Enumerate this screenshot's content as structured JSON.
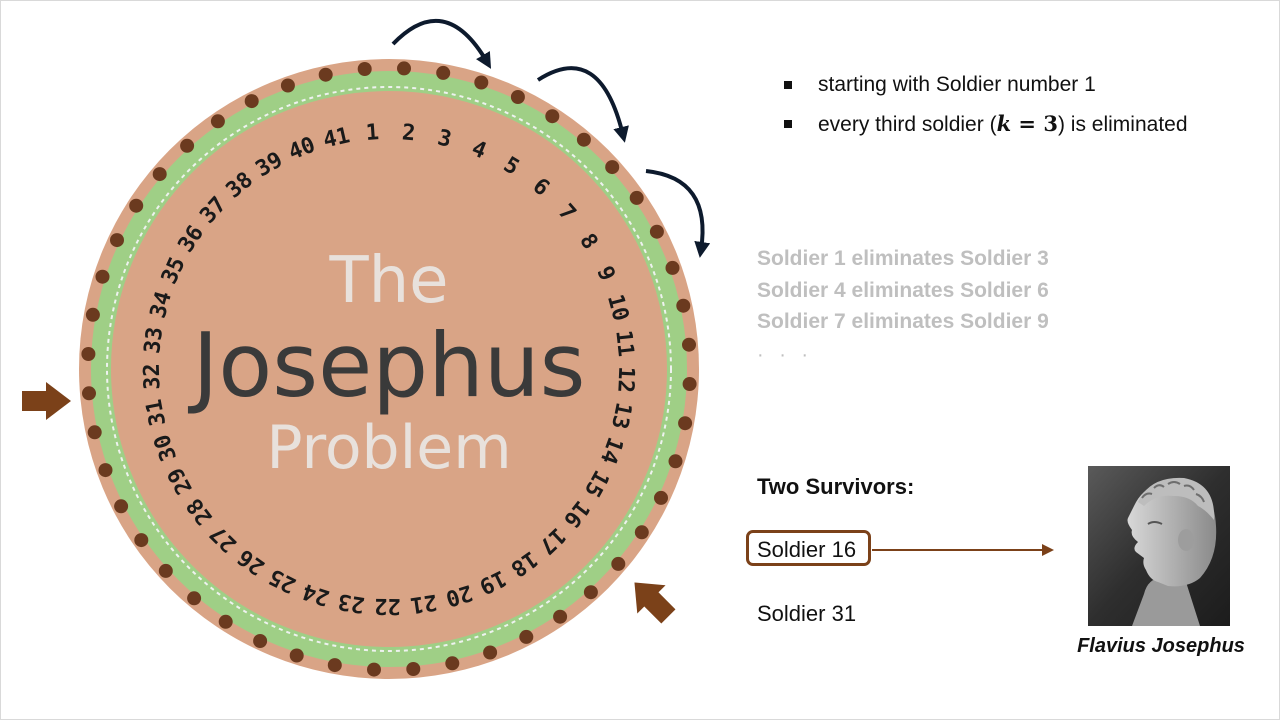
{
  "title": {
    "line1": "The",
    "line2": "Josephus",
    "line3": "Problem"
  },
  "soldier_numbers": [
    "1",
    "2",
    "3",
    "4",
    "5",
    "6",
    "7",
    "8",
    "9",
    "10",
    "11",
    "12",
    "13",
    "14",
    "15",
    "16",
    "17",
    "18",
    "19",
    "20",
    "21",
    "22",
    "23",
    "24",
    "25",
    "26",
    "27",
    "28",
    "29",
    "30",
    "31",
    "32",
    "33",
    "34",
    "35",
    "36",
    "37",
    "38",
    "39",
    "40",
    "41"
  ],
  "bullets": {
    "item1": "starting with Soldier number 1",
    "item2_before": "every third soldier (",
    "item2_math_var": "k",
    "item2_math_eq": " = 3",
    "item2_after": ") is eliminated"
  },
  "eliminations": [
    "Soldier 1 eliminates Soldier 3",
    "Soldier 4 eliminates Soldier 6",
    "Soldier 7 eliminates Soldier 9"
  ],
  "ellipsis": "· · ·",
  "survivors": {
    "heading": "Two Survivors:",
    "first": "Soldier 16",
    "second": "Soldier 31"
  },
  "portrait_caption": "Flavius Josephus",
  "colors": {
    "disc": "#d9a486",
    "ring_green": "#9fcf86",
    "accent_brown": "#7b4119",
    "arrow_navy": "#0d1a2d",
    "muted_text": "#bfbfbf"
  }
}
